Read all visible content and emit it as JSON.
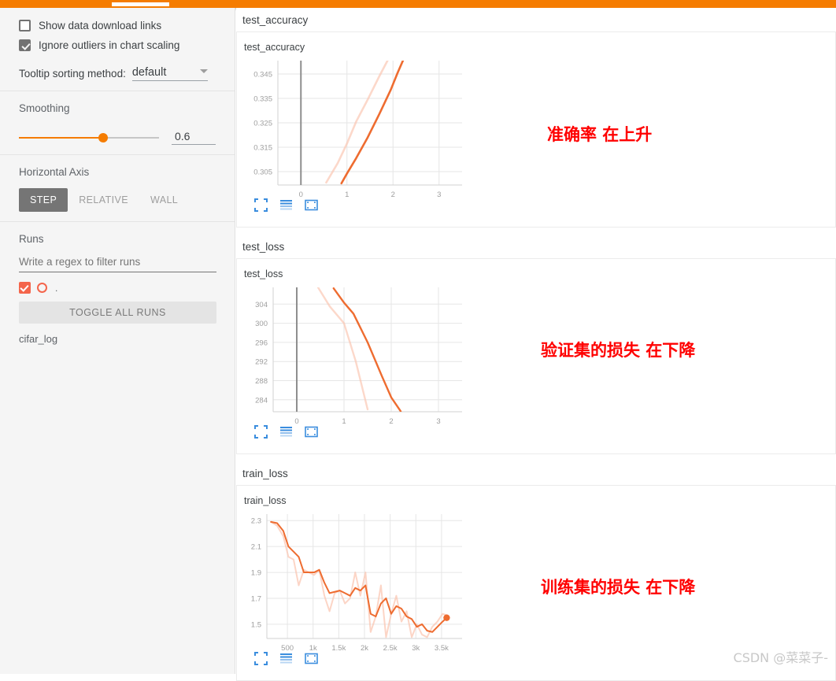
{
  "topbar": {
    "accent_color": "#f57c00",
    "active_tab_indicator": true
  },
  "sidebar": {
    "options": [
      {
        "label": "Show data download links",
        "checked": false
      },
      {
        "label": "Ignore outliers in chart scaling",
        "checked": true
      }
    ],
    "tooltip_sorting": {
      "label": "Tooltip sorting method:",
      "value": "default"
    },
    "smoothing": {
      "label": "Smoothing",
      "value": "0.6",
      "fraction": 60
    },
    "horizontal_axis": {
      "label": "Horizontal Axis",
      "buttons": [
        {
          "label": "STEP",
          "active": true
        },
        {
          "label": "RELATIVE",
          "active": false
        },
        {
          "label": "WALL",
          "active": false
        }
      ]
    },
    "runs": {
      "label": "Runs",
      "filter_placeholder": "Write a regex to filter runs",
      "filter_value": "",
      "row_label": ".",
      "toggle_all_label": "TOGGLE ALL RUNS",
      "run_name": "cifar_log",
      "run_color": "#f4654b"
    }
  },
  "watermark": "CSDN @菜菜子-",
  "cards": [
    {
      "header": "test_accuracy",
      "annotation": "准确率  在上升"
    },
    {
      "header": "test_loss",
      "annotation": "验证集的损失 在下降"
    },
    {
      "header": "train_loss",
      "annotation": "训练集的损失 在下降"
    }
  ],
  "chart_data": [
    {
      "type": "line",
      "title": "test_accuracy",
      "xlabel": "",
      "ylabel": "",
      "xticks": [
        0,
        1,
        2,
        3
      ],
      "xtick_labels": [
        "0",
        "1",
        "2",
        "3"
      ],
      "yticks": [
        0.305,
        0.315,
        0.325,
        0.335,
        0.345
      ],
      "ytick_labels": [
        "0.305",
        "0.315",
        "0.325",
        "0.335",
        "0.345"
      ],
      "xlim": [
        -0.5,
        3.5
      ],
      "ylim": [
        0.2995,
        0.3505
      ],
      "grid": true,
      "legend": "none",
      "series": [
        {
          "name": "cifar_log (raw)",
          "color": "#fbc3ae",
          "opacity": 0.65,
          "x": [
            0.55,
            0.8,
            1.0,
            1.2,
            1.45,
            1.7,
            1.95
          ],
          "y": [
            0.3005,
            0.3085,
            0.3165,
            0.3255,
            0.3345,
            0.344,
            0.353
          ]
        },
        {
          "name": "cifar_log (smoothed)",
          "color": "#ee6c30",
          "opacity": 1,
          "x": [
            0.88,
            1.0,
            1.2,
            1.45,
            1.7,
            1.95,
            2.1,
            2.25
          ],
          "y": [
            0.3002,
            0.3042,
            0.3105,
            0.319,
            0.3285,
            0.3385,
            0.3455,
            0.352
          ]
        }
      ]
    },
    {
      "type": "line",
      "title": "test_loss",
      "xlabel": "",
      "ylabel": "",
      "xticks": [
        0,
        1,
        2,
        3
      ],
      "xtick_labels": [
        "0",
        "1",
        "2",
        "3"
      ],
      "yticks": [
        284,
        288,
        292,
        296,
        300,
        304
      ],
      "ytick_labels": [
        "284",
        "288",
        "292",
        "296",
        "300",
        "304"
      ],
      "xlim": [
        -0.5,
        3.5
      ],
      "ylim": [
        281.5,
        307.5
      ],
      "grid": true,
      "legend": "none",
      "series": [
        {
          "name": "cifar_log (raw)",
          "color": "#fbc3ae",
          "opacity": 0.65,
          "x": [
            0.45,
            0.7,
            1.0,
            1.25,
            1.5
          ],
          "y": [
            307.5,
            303.5,
            300.0,
            292.0,
            282.0
          ]
        },
        {
          "name": "cifar_log (smoothed)",
          "color": "#ee6c30",
          "opacity": 1,
          "x": [
            0.78,
            1.0,
            1.2,
            1.5,
            1.8,
            2.0,
            2.2
          ],
          "y": [
            307.3,
            304.3,
            302.0,
            296.0,
            289.0,
            284.5,
            281.6
          ]
        }
      ]
    },
    {
      "type": "line",
      "title": "train_loss",
      "xlabel": "",
      "ylabel": "",
      "xticks": [
        500,
        1000,
        1500,
        2000,
        2500,
        3000,
        3500
      ],
      "xtick_labels": [
        "500",
        "1k",
        "1.5k",
        "2k",
        "2.5k",
        "3k",
        "3.5k"
      ],
      "yticks": [
        1.5,
        1.7,
        1.9,
        2.1,
        2.3
      ],
      "ytick_labels": [
        "1.5",
        "1.7",
        "1.9",
        "2.1",
        "2.3"
      ],
      "xlim": [
        100,
        3900
      ],
      "ylim": [
        1.39,
        2.35
      ],
      "grid": true,
      "legend": "none",
      "last_point": {
        "x": 3600,
        "y": 1.55,
        "marker": "dot",
        "color": "#ee6c30"
      },
      "series": [
        {
          "name": "cifar_log (raw)",
          "color": "#fbc3ae",
          "opacity": 0.7,
          "x": [
            180,
            300,
            420,
            520,
            620,
            720,
            820,
            920,
            1020,
            1120,
            1220,
            1320,
            1420,
            1520,
            1620,
            1720,
            1820,
            1920,
            2020,
            2120,
            2220,
            2320,
            2420,
            2520,
            2620,
            2720,
            2820,
            2920,
            3020,
            3120,
            3220,
            3320,
            3420,
            3520,
            3600
          ],
          "y": [
            2.29,
            2.26,
            2.18,
            2.02,
            2.0,
            1.8,
            1.92,
            1.9,
            1.88,
            1.92,
            1.72,
            1.6,
            1.74,
            1.76,
            1.66,
            1.7,
            1.9,
            1.72,
            1.9,
            1.44,
            1.56,
            1.8,
            1.4,
            1.58,
            1.72,
            1.52,
            1.6,
            1.4,
            1.5,
            1.42,
            1.4,
            1.48,
            1.52,
            1.58,
            1.57
          ]
        },
        {
          "name": "cifar_log (smoothed)",
          "color": "#ee6c30",
          "opacity": 1,
          "x": [
            180,
            300,
            420,
            520,
            620,
            720,
            820,
            920,
            1020,
            1120,
            1220,
            1320,
            1420,
            1520,
            1620,
            1720,
            1820,
            1920,
            2020,
            2120,
            2220,
            2320,
            2420,
            2520,
            2620,
            2720,
            2820,
            2920,
            3020,
            3120,
            3220,
            3320,
            3420,
            3520,
            3600
          ],
          "y": [
            2.29,
            2.28,
            2.22,
            2.1,
            2.06,
            2.02,
            1.9,
            1.9,
            1.9,
            1.92,
            1.82,
            1.74,
            1.75,
            1.76,
            1.74,
            1.72,
            1.78,
            1.76,
            1.8,
            1.58,
            1.56,
            1.66,
            1.7,
            1.58,
            1.64,
            1.62,
            1.56,
            1.54,
            1.48,
            1.5,
            1.45,
            1.44,
            1.48,
            1.52,
            1.55
          ]
        }
      ]
    }
  ],
  "chart_toolbar_icons": [
    "expand-icon",
    "data-series-icon",
    "fit-domain-icon"
  ]
}
